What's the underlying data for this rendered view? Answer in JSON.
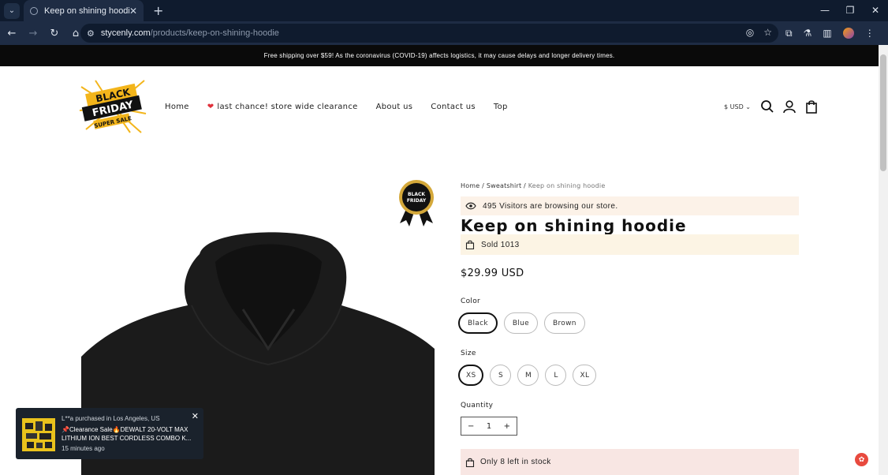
{
  "browser": {
    "tab_title": "Keep on shining hoodie",
    "tab_close": "✕",
    "new_tab": "+",
    "url_domain": "stycenly.com",
    "url_path": "/products/keep-on-shining-hoodie",
    "window_controls": [
      "—",
      "❐",
      "✕"
    ]
  },
  "announcement": "Free shipping over $59! As the coronavirus (COVID-19) affects logistics, it may cause delays and longer delivery times.",
  "logo": {
    "line1": "BLACK",
    "line2": "FRIDAY",
    "line3": "SUPER SALE"
  },
  "nav": {
    "home": "Home",
    "clearance": "last chance! store wide clearance",
    "about": "About us",
    "contact": "Contact us",
    "top": "Top"
  },
  "header": {
    "currency": "$ USD"
  },
  "badge": {
    "line1": "BLACK",
    "line2": "FRIDAY"
  },
  "breadcrumb": {
    "home": "Home",
    "sep1": " / ",
    "category": "Sweatshirt",
    "sep2": " / ",
    "current": "Keep on shining hoodie"
  },
  "product": {
    "visitors": "495 Visitors are browsing our store.",
    "title": "Keep on shining hoodie",
    "sold": "Sold 1013",
    "price": "$29.99 USD",
    "color_label": "Color",
    "colors": [
      "Black",
      "Blue",
      "Brown"
    ],
    "size_label": "Size",
    "sizes": [
      "XS",
      "S",
      "M",
      "L",
      "XL"
    ],
    "quantity_label": "Quantity",
    "quantity_value": "1",
    "qty_minus": "−",
    "qty_plus": "+",
    "stock": "Only 8 left in stock"
  },
  "popup": {
    "line1": "L**a purchased in Los Angeles, US",
    "line2": "📌Clearance Sale🔥DEWALT 20-VOLT MAX LITHIUM ION BEST CORDLESS COMBO K...",
    "line3": "15 minutes ago",
    "close": "✕"
  },
  "colors": {
    "announce_bg": "#0a0a0a",
    "visitors_bg": "#fcf2e8",
    "stock_bg": "#f8e6e3",
    "accent": "#e84a3e"
  }
}
